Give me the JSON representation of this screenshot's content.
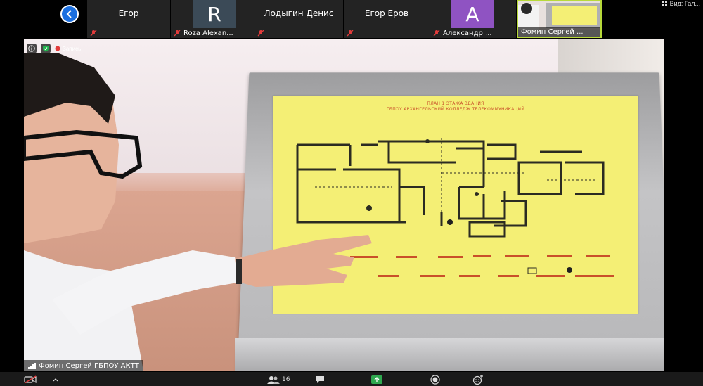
{
  "participants": [
    {
      "name": "Егор",
      "type": "name"
    },
    {
      "name": "Roza Alexan...",
      "type": "avatar",
      "initial": "R",
      "avatar_color": "#3b4a57"
    },
    {
      "name": "Лодыгин Денис",
      "type": "name"
    },
    {
      "name": "Егор Еров",
      "type": "name"
    },
    {
      "name": "Александр ...",
      "type": "avatar",
      "initial": "A",
      "avatar_color": "#8f53c2"
    },
    {
      "name": "Фомин Сергей ...",
      "type": "self"
    }
  ],
  "top_right_label": "Вид: Гал...",
  "recording_label": "Запись",
  "speaker_label": "Фомин Сергей ГБПОУ АКТТ",
  "participants_count": "16",
  "plan_title_lines": [
    "ПЛАН 1 ЭТАЖА ЗДАНИЯ",
    "ГБПОУ АРХАНГЕЛЬСКИЙ КОЛЛЕДЖ ТЕЛЕКОММУНИКАЦИЙ"
  ],
  "colors": {
    "accent": "#1a6fe0",
    "active_speaker_border": "#b7d93a",
    "share": "#2fa84f",
    "plan_paper": "#f4ef75"
  }
}
